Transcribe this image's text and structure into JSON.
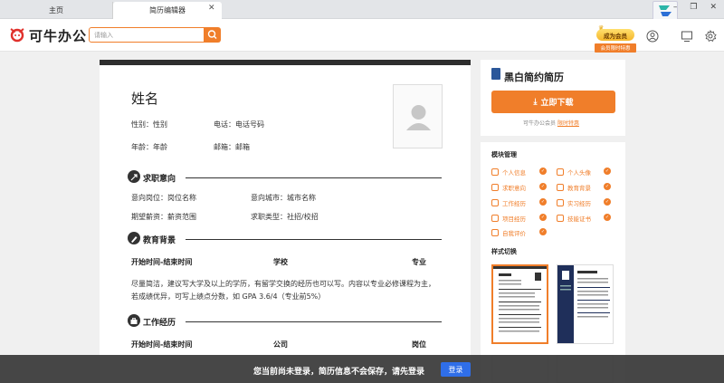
{
  "tabs": [
    {
      "label": "主页"
    },
    {
      "label": "简历编辑器"
    }
  ],
  "tab_close": "✕",
  "window_controls": [
    "–",
    "❐",
    "✕"
  ],
  "logo": {
    "text": "可牛办公"
  },
  "search": {
    "placeholder": "请输入"
  },
  "vip": {
    "label": "成为会员",
    "promo": "会员限时特惠"
  },
  "resume": {
    "name": "姓名",
    "gender": "性别：性别",
    "phone": "电话：电话号码",
    "age": "年龄：年龄",
    "email": "邮箱：邮箱",
    "sections": {
      "intent": {
        "title": "求职意向",
        "position": "意向岗位：岗位名称",
        "city": "意向城市：城市名称",
        "salary": "期望薪资：薪资范围",
        "type": "求职类型：社招/校招"
      },
      "education": {
        "title": "教育背景",
        "columns": [
          "开始时间-结束时间",
          "学校",
          "专业"
        ],
        "desc_line1": "尽量简洁，建议写大学及以上的学历，有留学交换的经历也可以写。内容以专业必修课程为主，",
        "desc_line2": "若成绩优异，可写上绩点分数，如 GPA 3.6/4（专业前5%）"
      },
      "work": {
        "title": "工作经历",
        "columns": [
          "开始时间-结束时间",
          "公司",
          "岗位"
        ]
      }
    }
  },
  "download": {
    "title": "黑白简约简历",
    "button": "立即下载",
    "note": "可牛办公会员",
    "note_link": "限时特惠"
  },
  "modules": {
    "title": "模块管理",
    "items": [
      {
        "label": "个人信息"
      },
      {
        "label": "个人头像"
      },
      {
        "label": "求职意向"
      },
      {
        "label": "教育背景"
      },
      {
        "label": "工作经历"
      },
      {
        "label": "实习经历"
      },
      {
        "label": "项目经历"
      },
      {
        "label": "技能证书"
      },
      {
        "label": "自我评价"
      }
    ],
    "check": "✓"
  },
  "styles": {
    "title": "样式切换"
  },
  "banner": {
    "text": "您当前尚未登录，简历信息不会保存，请先登录",
    "login": "登录"
  },
  "colors": {
    "accent": "#f07e2a",
    "dark": "#2e2e2e",
    "login": "#2f6ee8"
  }
}
